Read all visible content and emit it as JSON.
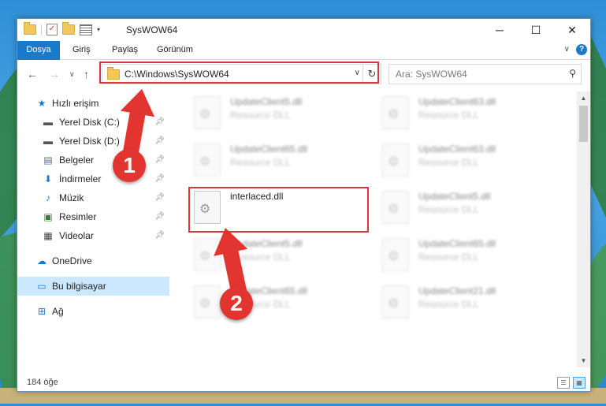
{
  "window": {
    "title": "SysWOW64"
  },
  "ribbon": {
    "tabs": [
      "Dosya",
      "Giriş",
      "Paylaş",
      "Görünüm"
    ],
    "help": "?"
  },
  "nav": {
    "address": "C:\\Windows\\SysWOW64",
    "search_placeholder": "Ara: SysWOW64"
  },
  "sidebar": {
    "quick_access": "Hızlı erişim",
    "pinned": [
      "Yerel Disk (C:)",
      "Yerel Disk (D:)",
      "Belgeler",
      "İndirmeler",
      "Müzik",
      "Resimler",
      "Videolar"
    ],
    "onedrive": "OneDrive",
    "this_pc": "Bu bilgisayar",
    "network": "Ağ"
  },
  "files": [
    {
      "name": "UpdateClient5.dll",
      "type": "Resource DLL"
    },
    {
      "name": "UpdateClient63.dll",
      "type": "Resource DLL"
    },
    {
      "name": "UpdateClient65.dll",
      "type": "Resource DLL"
    },
    {
      "name": "UpdateClient63.dll",
      "type": "Resource DLL"
    },
    {
      "name": "interlaced.dll",
      "type": ""
    },
    {
      "name": "UpdateClient5.dll",
      "type": "Resource DLL"
    },
    {
      "name": "UpdateClient5.dll",
      "type": "Resource DLL"
    },
    {
      "name": "UpdateClient65.dll",
      "type": "Resource DLL"
    },
    {
      "name": "UpdateClient65.dll",
      "type": "Resource DLL"
    },
    {
      "name": "UpdateClient21.dll",
      "type": "Resource DLL"
    }
  ],
  "status": {
    "count": "184 öğe"
  },
  "annotations": {
    "step1": "1",
    "step2": "2",
    "color": "#e2352f"
  }
}
